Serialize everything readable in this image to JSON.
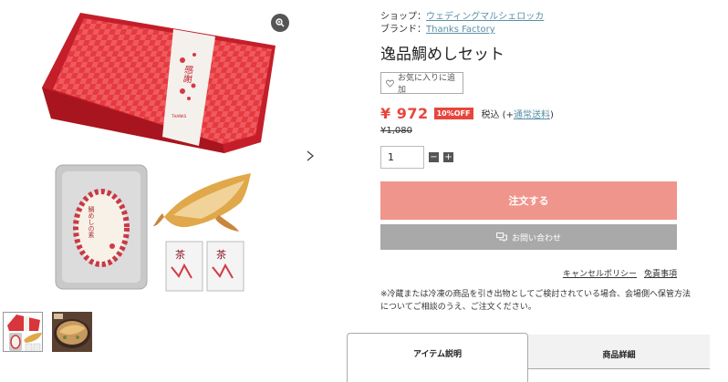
{
  "gallery": {
    "main_box_label": "感謝",
    "main_box_sub": "THANKS",
    "pouch_label": "鯛めしの素",
    "seasoning_label": "茶"
  },
  "shop": {
    "label": "ショップ：",
    "name": "ウェディングマルシェロッカ"
  },
  "brand": {
    "label": "ブランド：",
    "name": "Thanks Factory"
  },
  "product": {
    "title": "逸品鯛めしセット"
  },
  "favorite": {
    "label": "お気に入りに追加"
  },
  "price": {
    "current": "¥ 972",
    "discount_badge": "10%OFF",
    "tax_prefix": "税込 (+",
    "shipping_link": "通常送料",
    "tax_suffix": ")",
    "original": "¥1,080"
  },
  "quantity": {
    "value": "1",
    "minus": "−",
    "plus": "+"
  },
  "buttons": {
    "order": "注文する",
    "contact": "お問い合わせ"
  },
  "links": {
    "cancel_policy": "キャンセルポリシー",
    "disclaimer": "免責事項"
  },
  "notice": "※冷蔵または冷凍の商品を引き出物としてご検討されている場合、会場側へ保管方法についてご相談のうえ、ご注文ください。",
  "tabs": [
    {
      "label": "アイテム説明",
      "active": true
    },
    {
      "label": "商品詳細",
      "active": false
    }
  ],
  "colors": {
    "accent_red": "#e8453c",
    "order_button": "#f0958c",
    "contact_button": "#a9a9a9",
    "link": "#5b8fa8"
  }
}
